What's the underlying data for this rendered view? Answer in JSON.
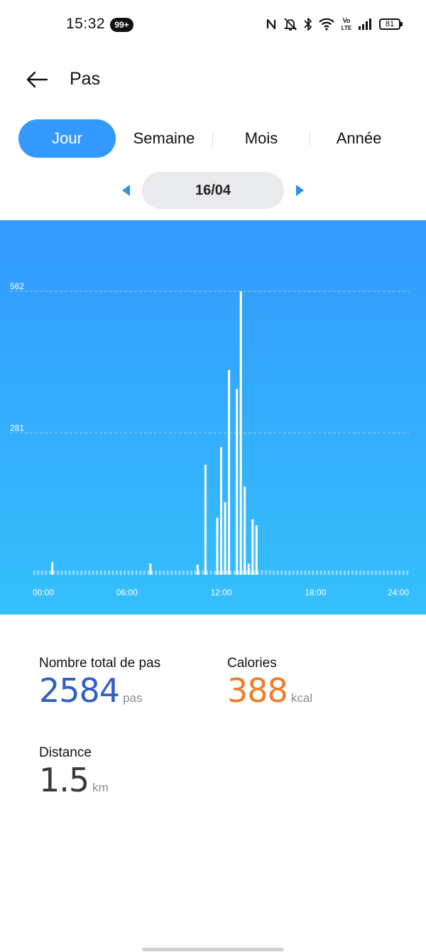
{
  "status_bar": {
    "time": "15:32",
    "notification_badge": "99+",
    "battery": "81",
    "icons": [
      "nfc-icon",
      "silent-bell-icon",
      "bluetooth-icon",
      "wifi-icon",
      "volte-icon",
      "signal-icon",
      "battery-icon"
    ],
    "volte_label_top": "Vo",
    "volte_label_bottom": "LTE"
  },
  "header": {
    "title": "Pas",
    "back_icon": "arrow-left-icon"
  },
  "tabs": [
    {
      "label": "Jour",
      "active": true
    },
    {
      "label": "Semaine",
      "active": false
    },
    {
      "label": "Mois",
      "active": false
    },
    {
      "label": "Année",
      "active": false
    }
  ],
  "date_nav": {
    "date": "16/04",
    "prev_icon": "triangle-left-icon",
    "next_icon": "triangle-right-icon"
  },
  "colors": {
    "accent": "#3399ff",
    "chart_top": "#3399ff",
    "chart_bottom": "#35c0fb",
    "steps": "#2f5fc8",
    "calories": "#f07c2c",
    "distance": "#3a3a3a"
  },
  "chart_data": {
    "type": "bar",
    "ylim": [
      0,
      562
    ],
    "y_ticks": [
      {
        "value": 562,
        "label": "562"
      },
      {
        "value": 281,
        "label": "281"
      }
    ],
    "x_ticks": [
      {
        "hour": 0,
        "label": "00:00"
      },
      {
        "hour": 6,
        "label": "06:00"
      },
      {
        "hour": 12,
        "label": "12:00"
      },
      {
        "hour": 18,
        "label": "18:00"
      },
      {
        "hour": 24,
        "label": "24:00"
      }
    ],
    "bar_interval_minutes": 15,
    "bars": [
      {
        "time": "01:15",
        "value": 25
      },
      {
        "time": "07:30",
        "value": 22
      },
      {
        "time": "10:30",
        "value": 20
      },
      {
        "time": "11:00",
        "value": 218
      },
      {
        "time": "11:45",
        "value": 113
      },
      {
        "time": "12:00",
        "value": 253
      },
      {
        "time": "12:15",
        "value": 144
      },
      {
        "time": "12:30",
        "value": 406
      },
      {
        "time": "13:00",
        "value": 368
      },
      {
        "time": "13:15",
        "value": 562
      },
      {
        "time": "13:30",
        "value": 175
      },
      {
        "time": "13:45",
        "value": 22
      },
      {
        "time": "14:00",
        "value": 110
      },
      {
        "time": "14:15",
        "value": 98
      }
    ],
    "grid": "dashed lines at tick values"
  },
  "stats": {
    "steps": {
      "label": "Nombre total de pas",
      "value": "2584",
      "unit": "pas"
    },
    "calories": {
      "label": "Calories",
      "value": "388",
      "unit": "kcal"
    },
    "distance": {
      "label": "Distance",
      "value": "1.5",
      "unit": "km"
    }
  }
}
